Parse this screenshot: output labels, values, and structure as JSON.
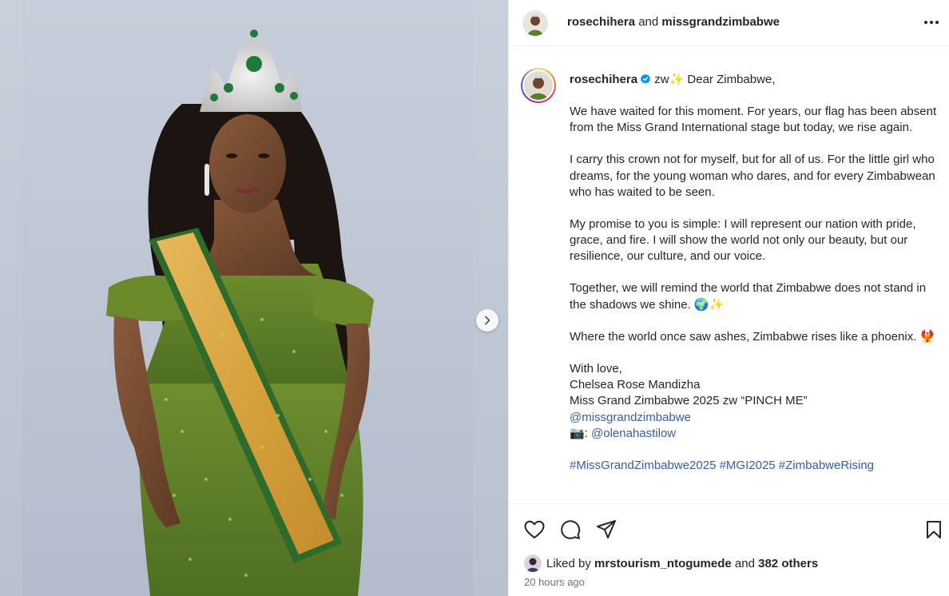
{
  "header": {
    "user1": "rosechihera",
    "joiner": "and",
    "user2": "missgrandzimbabwe"
  },
  "caption": {
    "username": "rosechihera",
    "prefix": "zw✨",
    "greeting": "Dear Zimbabwe,",
    "paragraphs": [
      "We have waited for this moment. For years, our flag has been absent from the Miss Grand International stage but today, we rise again.",
      "I carry this crown not for myself, but for all of us. For the little girl who dreams, for the young woman who dares, and for every Zimbabwean who has waited to be seen.",
      "My promise to you is simple: I will represent our nation with pride, grace, and fire. I will show the world not only our beauty, but our resilience, our culture, and our voice.",
      "Together, we will remind the world that Zimbabwe does not stand in the shadows we shine. 🌍✨",
      "Where the world once saw ashes, Zimbabwe rises like a phoenix. 🐦‍🔥"
    ],
    "signoff": "With love,",
    "name": "Chelsea Rose Mandizha",
    "tagline": "Miss Grand Zimbabwe 2025 zw “PINCH ME”",
    "mention": "@missgrandzimbabwe",
    "photo_prefix": "📷: ",
    "photographer": "@olenahastilow",
    "hashtags": "#MissGrandZimbabwe2025 #MGI2025 #ZimbabweRising"
  },
  "likes": {
    "prefix": "Liked by",
    "user": "mrstourism_ntogumede",
    "joiner": "and",
    "others": "382 others"
  },
  "time_ago": "20 hours ago",
  "icons": {
    "like": "heart-icon",
    "comment": "comment-icon",
    "share": "send-icon",
    "save": "bookmark-icon",
    "more": "more-icon",
    "next": "chevron-right-icon",
    "verified": "verified-badge-icon"
  },
  "colors": {
    "link": "#385ca8",
    "verified": "#0095f6",
    "muted": "#737373",
    "text": "#262626"
  }
}
